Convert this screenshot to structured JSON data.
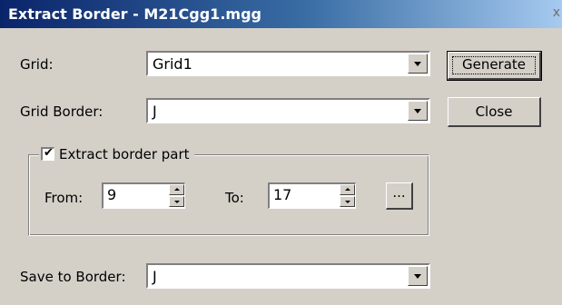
{
  "window": {
    "title": "Extract Border - M21Cgg1.mgg",
    "close_glyph": "x"
  },
  "fields": {
    "grid_label": "Grid:",
    "grid_value": "Grid1",
    "grid_border_label": "Grid Border:",
    "grid_border_value": "J",
    "save_to_border_label": "Save to Border:",
    "save_to_border_value": "J"
  },
  "group": {
    "checkbox_label": "Extract border part",
    "checked": true,
    "check_glyph": "✔",
    "from_label": "From:",
    "from_value": "9",
    "to_label": "To:",
    "to_value": "17",
    "browse_label": "..."
  },
  "buttons": {
    "generate": "Generate",
    "close": "Close"
  },
  "icons": [
    "dropdown-arrow-icon",
    "spin-up-icon",
    "spin-down-icon",
    "checkbox-check-icon"
  ]
}
